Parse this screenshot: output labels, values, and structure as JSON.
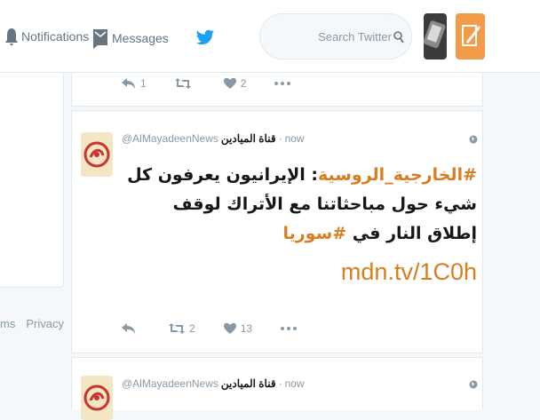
{
  "nav": {
    "notifications_label": "Notifications",
    "messages_label": "Messages"
  },
  "search": {
    "placeholder": "Search Twitter"
  },
  "left": {
    "links": [
      "ms",
      "Privacy"
    ]
  },
  "prev_tweet": {
    "reply_count": "1",
    "retweet_count": "",
    "like_count": "2"
  },
  "tweets": [
    {
      "display_name": "قناة الميادين",
      "handle": "@AlMayadeenNews",
      "separator": "·",
      "time": "now",
      "text_hashtag": "#الخارجية_الروسية",
      "text_body": ": الإيرانيون يعرفون كل شيء حول مباحثاتنا مع الأتراك لوقف إطلاق النار في ",
      "text_hashtag2": "#سوريا",
      "link": "mdn.tv/1C0h",
      "reply_count": "",
      "retweet_count": "2",
      "like_count": "13"
    },
    {
      "display_name": "قناة الميادين",
      "handle": "@AlMayadeenNews",
      "separator": "·",
      "time": "now"
    }
  ],
  "colors": {
    "brand": "#1da1f2",
    "accent": "#d87e1f"
  }
}
